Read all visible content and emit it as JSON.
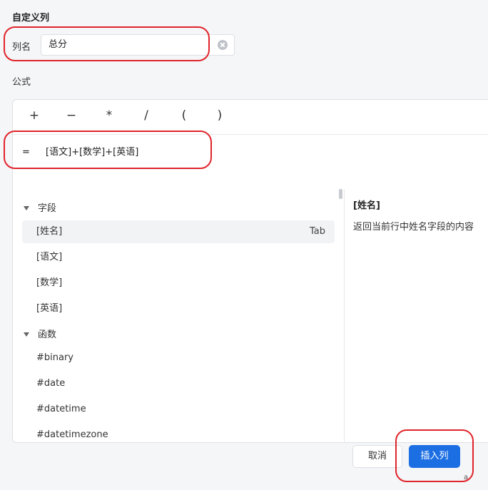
{
  "dialog": {
    "title": "自定义列"
  },
  "column_name": {
    "label": "列名",
    "value": "总分"
  },
  "formula": {
    "label": "公式",
    "operators": [
      "+",
      "−",
      "*",
      "/",
      "(",
      ")"
    ],
    "equals": "=",
    "expression": "[语文]+[数学]+[英语]"
  },
  "fields": {
    "group_label": "字段",
    "items": [
      {
        "label": "[姓名]",
        "hint": "Tab"
      },
      {
        "label": "[语文]"
      },
      {
        "label": "[数学]"
      },
      {
        "label": "[英语]"
      }
    ]
  },
  "functions": {
    "group_label": "函数",
    "items": [
      {
        "label": "#binary"
      },
      {
        "label": "#date"
      },
      {
        "label": "#datetime"
      },
      {
        "label": "#datetimezone"
      }
    ]
  },
  "description": {
    "title": "[姓名]",
    "text": "返回当前行中姓名字段的内容"
  },
  "footer": {
    "cancel_label": "取消",
    "insert_label": "插入列",
    "corner_glyph": "a"
  },
  "colors": {
    "primary": "#1c6fe3",
    "highlight_ring": "#e0242b"
  }
}
